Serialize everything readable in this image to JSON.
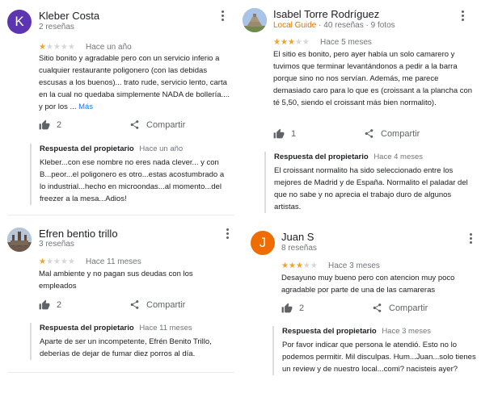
{
  "colors": {
    "star": "#f4a02b",
    "star_empty": "#d6d6d6",
    "local_guide": "#e37400",
    "link": "#1a73e8"
  },
  "actions": {
    "share_label": "Compartir"
  },
  "reviews": [
    {
      "name": "Kleber Costa",
      "avatar_letter": "K",
      "avatar_color": "#5e35b1",
      "meta": "2 reseñas",
      "rating": 1,
      "time": "Hace un año",
      "text": "Sitio bonito y agradable pero con un servicio inferio a cualquier restaurante poligonero (con las debidas escusas a los buenos)... trato rude, servicio lento, carta en la cual no quedaba simplemente NADA de bollería.... y por los ...",
      "more": "Más",
      "likes": "2",
      "owner_title": "Respuesta del propietario",
      "owner_time": "Hace un año",
      "owner_text": "Kleber...con ese nombre no eres nada clever... y con B...peor...el poligonero es otro...estas acostumbrado a lo industrial...hecho en microondas...al momento...del freezer a la mesa...Adios!"
    },
    {
      "name": "Efren bentio trillo",
      "avatar_type": "photo",
      "meta": "3 reseñas",
      "rating": 1,
      "time": "Hace 11 meses",
      "text": "Mal ambiente y no pagan sus deudas con los empleados",
      "likes": "2",
      "owner_title": "Respuesta del propietario",
      "owner_time": "Hace 11 meses",
      "owner_text": "Aparte de ser un incompetente, Efrén Benito Trillo, deberías de dejar de fumar diez porros al día."
    },
    {
      "name": "Isabel Torre Rodríguez",
      "avatar_type": "photo",
      "local_guide": "Local Guide",
      "meta": "· 40 reseñas · 9 fotos",
      "rating": 3,
      "time": "Hace 5 meses",
      "text": "El sitio es bonito, pero ayer había un solo camarero y tuvimos que terminar levantándonos a pedir a la barra porque sino no nos servían. Además, me parece demasiado caro para lo que es (croissant a la plancha con té 5,50, siendo el croissant más bien normalito).",
      "likes": "1",
      "owner_title": "Respuesta del propietario",
      "owner_time": "Hace 4 meses",
      "owner_text": "El croissant normalito ha sido seleccionado entre los mejores de Madrid y de España. Normalito el paladar del que no sabe y no aprecia el trabajo duro de algunos artistas."
    },
    {
      "name": "Juan S",
      "avatar_letter": "J",
      "avatar_color": "#ef6c00",
      "meta": "8 reseñas",
      "rating": 3,
      "time": "Hace 3 meses",
      "text": "Desayuno muy bueno pero con atencion muy poco agradable por parte de una de las camareras",
      "likes": "2",
      "owner_title": "Respuesta del propietario",
      "owner_time": "Hace 3 meses",
      "owner_text": "Por favor indicar que persona le atendió. Esto no lo podemos permitir. Mil disculpas.  Hum...Juan...solo tienes un review y de nuestro local...comi? nacisteis ayer?"
    }
  ]
}
